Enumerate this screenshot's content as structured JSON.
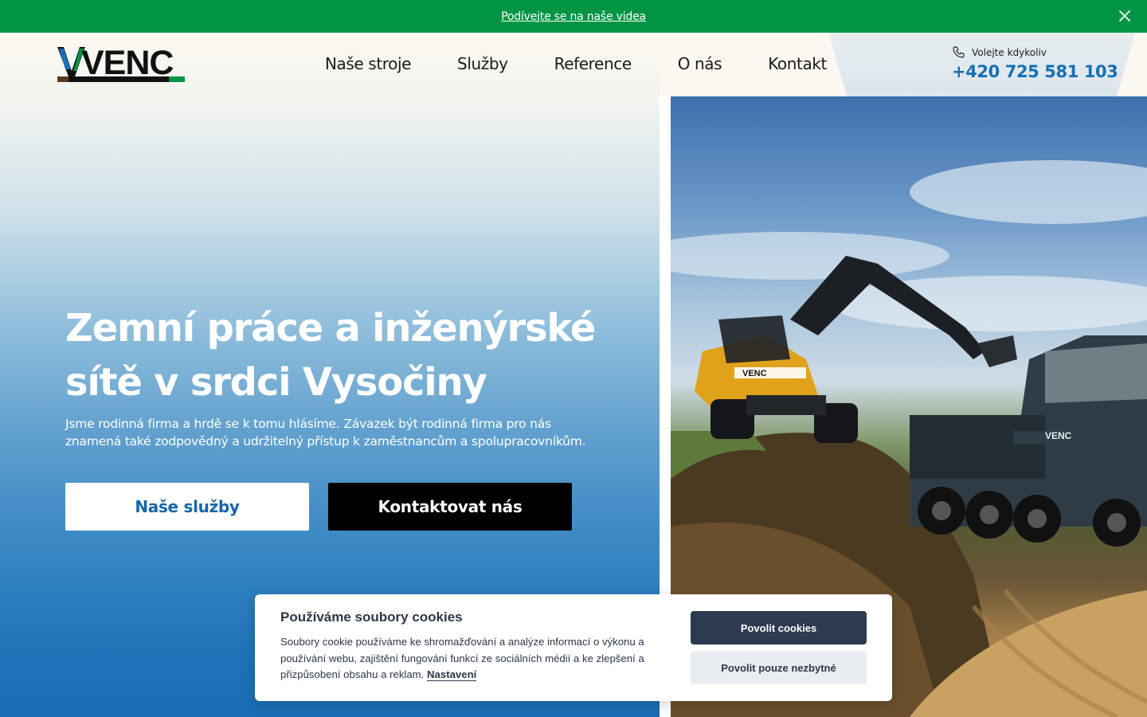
{
  "topbar": {
    "link_text": "Podívejte se na naše videa",
    "close_icon": "close-icon",
    "background": "#009444"
  },
  "logo": {
    "text": "VENC",
    "icon": "venc-logo-icon"
  },
  "nav": {
    "items": [
      {
        "label": "Naše stroje"
      },
      {
        "label": "Služby"
      },
      {
        "label": "Reference"
      },
      {
        "label": "O nás"
      },
      {
        "label": "Kontakt"
      }
    ]
  },
  "phone": {
    "label": "Volejte kdykoliv",
    "number": "+420 725 581 103",
    "icon": "phone-icon",
    "color": "#1770b3"
  },
  "hero": {
    "title": "Zemní práce a inženýrské sítě v srdci Vysočiny",
    "subtitle": "Jsme rodinná firma a hrdě se k tomu hlásíme. Závazek být rodinná firma pro nás znamená také zodpovědný a udržitelný přístup k zaměstnancům a spolupracovníkům.",
    "btn_services": "Naše služby",
    "btn_contact": "Kontaktovat nás"
  },
  "photo": {
    "excavator_label": "VENC",
    "truck_label": "VENC"
  },
  "cookie": {
    "title": "Používáme soubory cookies",
    "text": "Soubory cookie používáme ke shromažďování a analýze informací o výkonu a používání webu, zajištění fungování funkcí ze sociálních médií a ke zlepšení a přizpůsobení obsahu a reklam.",
    "settings_link": "Nastavení",
    "accept": "Povolit cookies",
    "necessary": "Povolit pouze nezbytné",
    "accept_color": "#2d3b52"
  }
}
